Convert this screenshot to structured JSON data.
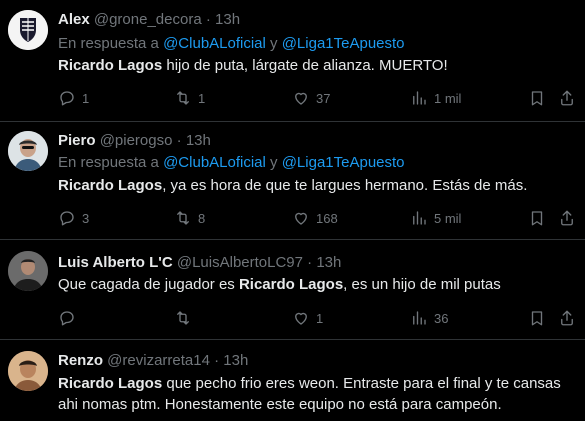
{
  "reply_prefix": "En respuesta a",
  "reply_joiner": "y",
  "tweets": [
    {
      "name": "Alex",
      "handle": "@grone_decora",
      "dot": "·",
      "time": "13h",
      "reply_to": [
        "@ClubALoficial",
        "@Liga1TeApuesto"
      ],
      "bold": "Ricardo Lagos",
      "text": " hijo de puta, lárgate de alianza. MUERTO!",
      "replies": "1",
      "retweets": "1",
      "likes": "37",
      "views": "1 mil"
    },
    {
      "name": "Piero",
      "handle": "@pierogso",
      "dot": "·",
      "time": "13h",
      "reply_to": [
        "@ClubALoficial",
        "@Liga1TeApuesto"
      ],
      "bold": "Ricardo Lagos",
      "text": ", ya es hora de que te largues hermano. Estás de más.",
      "replies": "3",
      "retweets": "8",
      "likes": "168",
      "views": "5 mil"
    },
    {
      "name": "Luis Alberto L'C",
      "handle": "@LuisAlbertoLC97",
      "dot": "·",
      "time": "13h",
      "pre": "Que cagada de jugador es ",
      "bold": "Ricardo Lagos",
      "text": ", es un hijo de mil putas",
      "replies": "",
      "retweets": "",
      "likes": "1",
      "views": "36"
    },
    {
      "name": "Renzo",
      "handle": "@revizarreta14",
      "dot": "·",
      "time": "13h",
      "bold": "Ricardo Lagos",
      "text": " que pecho frio eres weon. Entraste para el final y te cansas",
      "text2": "ahi nomas ptm. Honestamente este equipo no está para campeón."
    }
  ]
}
